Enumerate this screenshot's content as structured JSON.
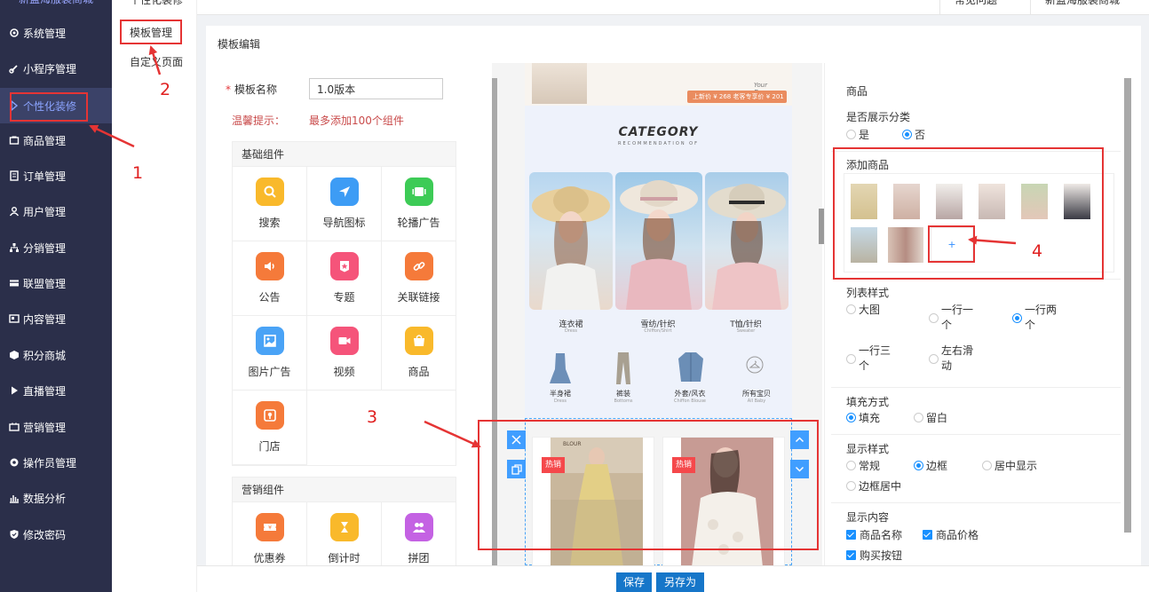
{
  "app": {
    "brand": "新蓝海服装商城"
  },
  "topbar": {
    "btn1": "常见问题",
    "btn2": "新蓝海服装商城"
  },
  "sidebar": {
    "items": [
      {
        "label": "系统管理",
        "icon": "gear-icon"
      },
      {
        "label": "小程序管理",
        "icon": "link-icon"
      },
      {
        "label": "个性化装修",
        "icon": "paint-icon"
      },
      {
        "label": "商品管理",
        "icon": "shop-icon"
      },
      {
        "label": "订单管理",
        "icon": "order-icon"
      },
      {
        "label": "用户管理",
        "icon": "user-icon"
      },
      {
        "label": "分销管理",
        "icon": "distribution-icon"
      },
      {
        "label": "联盟管理",
        "icon": "card-icon"
      },
      {
        "label": "内容管理",
        "icon": "content-icon"
      },
      {
        "label": "积分商城",
        "icon": "points-icon"
      },
      {
        "label": "直播管理",
        "icon": "play-icon"
      },
      {
        "label": "营销管理",
        "icon": "marketing-icon"
      },
      {
        "label": "操作员管理",
        "icon": "operator-icon"
      },
      {
        "label": "数据分析",
        "icon": "chart-icon"
      },
      {
        "label": "修改密码",
        "icon": "shield-icon"
      }
    ]
  },
  "submenu": {
    "top": "个性化装修",
    "template": "模板管理",
    "custom": "自定义页面"
  },
  "editor": {
    "title": "模板编辑",
    "name_label": "模板名称",
    "name_value": "1.0版本",
    "hint_label": "温馨提示：",
    "hint_text": "最多添加100个组件",
    "basic_group": "基础组件",
    "basic_items": [
      "搜索",
      "导航图标",
      "轮播广告",
      "公告",
      "专题",
      "关联链接",
      "图片广告",
      "视频",
      "商品",
      "门店"
    ],
    "marketing_group": "营销组件",
    "marketing_items": [
      "优惠券",
      "倒计时",
      "拼团"
    ]
  },
  "preview": {
    "banner_text": "Your Dress...",
    "price_tag": "上新价 ¥ 268    老客专享价 ¥ 201",
    "category_title": "CATEGORY",
    "category_sub": "RECOMMENDATION OF",
    "models": [
      {
        "label": "连衣裙",
        "sub": "Dress"
      },
      {
        "label": "雪纺/针织",
        "sub": "Chiffon/Shirt"
      },
      {
        "label": "T恤/针织",
        "sub": "Sweater"
      }
    ],
    "clothes": [
      {
        "label": "半身裙",
        "sub": "Dress"
      },
      {
        "label": "裤装",
        "sub": "Bottoms"
      },
      {
        "label": "外套/风衣",
        "sub": "Chiffon Blouse"
      },
      {
        "label": "所有宝贝",
        "sub": "All Baby"
      }
    ],
    "hot_badge": "热销",
    "hot_badge2": "热销",
    "goods_brand": "BLOUR"
  },
  "settings": {
    "section_title": "商品",
    "show_category": {
      "label": "是否展示分类",
      "yes": "是",
      "no": "否"
    },
    "add_goods": "添加商品",
    "add_symbol": "+",
    "list_style": {
      "label": "列表样式",
      "big": "大图",
      "one": "一行一个",
      "two": "一行两个",
      "three": "一行三个",
      "slide": "左右滑动"
    },
    "fill": {
      "label": "填充方式",
      "fill": "填充",
      "blank": "留白"
    },
    "display_style": {
      "label": "显示样式",
      "normal": "常规",
      "border": "边框",
      "center": "居中显示",
      "border_center": "边框居中"
    },
    "display_content": {
      "label": "显示内容",
      "name": "商品名称",
      "price": "商品价格",
      "buy": "购买按钮"
    }
  },
  "footer": {
    "save": "保存",
    "save_as": "另存为"
  },
  "annotations": {
    "n1": "1",
    "n2": "2",
    "n3": "3",
    "n4": "4"
  }
}
